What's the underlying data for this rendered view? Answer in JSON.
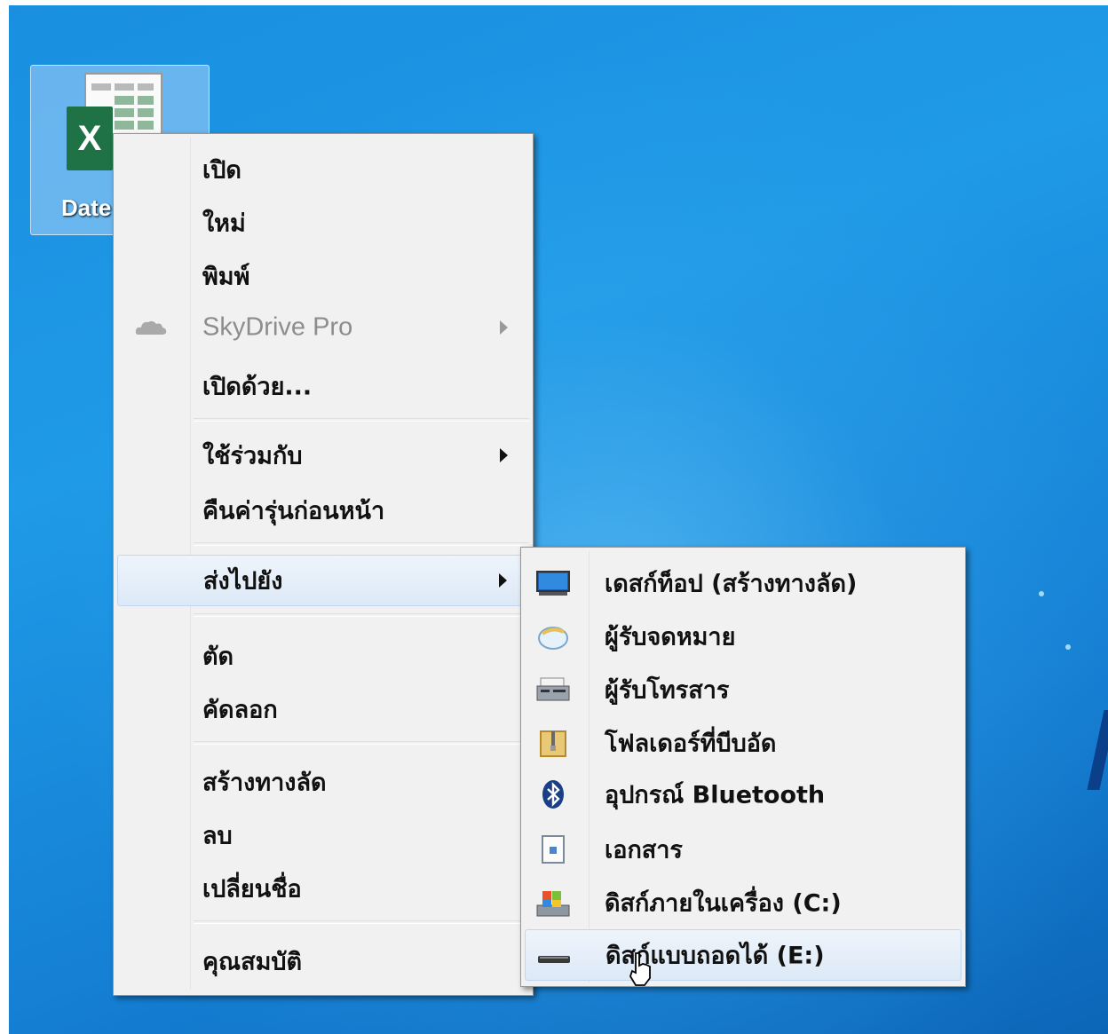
{
  "desktop": {
    "icon_label": "Date"
  },
  "context_menu": {
    "items": [
      {
        "label": "เปิด"
      },
      {
        "label": "ใหม่"
      },
      {
        "label": "พิมพ์"
      },
      {
        "label": "SkyDrive Pro"
      },
      {
        "label": "เปิดด้วย..."
      },
      {
        "label": "ใช้ร่วมกับ"
      },
      {
        "label": "คืนค่ารุ่นก่อนหน้า"
      },
      {
        "label": "ส่งไปยัง"
      },
      {
        "label": "ตัด"
      },
      {
        "label": "คัดลอก"
      },
      {
        "label": "สร้างทางลัด"
      },
      {
        "label": "ลบ"
      },
      {
        "label": "เปลี่ยนชื่อ"
      },
      {
        "label": "คุณสมบัติ"
      }
    ]
  },
  "send_to_menu": {
    "items": [
      {
        "label": "เดสก์ท็อป (สร้างทางลัด)",
        "icon": "desktop-icon"
      },
      {
        "label": "ผู้รับจดหมาย",
        "icon": "mail-recipient-icon"
      },
      {
        "label": "ผู้รับโทรสาร",
        "icon": "fax-icon"
      },
      {
        "label": "โฟลเดอร์ที่บีบอัด",
        "icon": "zip-folder-icon"
      },
      {
        "label": "อุปกรณ์ Bluetooth",
        "icon": "bluetooth-icon"
      },
      {
        "label": "เอกสาร",
        "icon": "documents-icon"
      },
      {
        "label": "ดิสก์ภายในเครื่อง (C:)",
        "icon": "local-disk-icon"
      },
      {
        "label": "ดิสก์แบบถอดได้ (E:)",
        "icon": "removable-disk-icon"
      }
    ]
  },
  "colors": {
    "excel_green": "#1e7245",
    "hover_blue": "#dde9f7",
    "desktop_blue": "#1a8fe0"
  }
}
